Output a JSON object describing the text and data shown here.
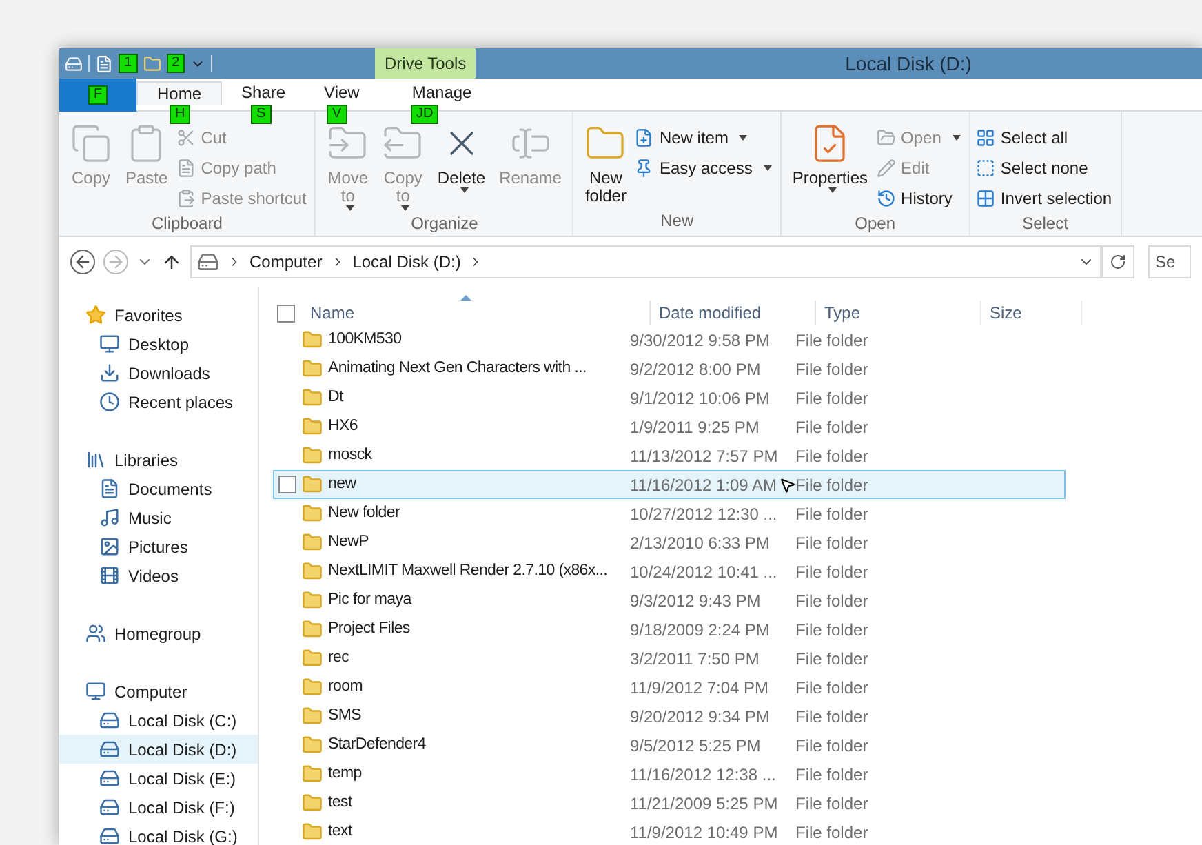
{
  "window": {
    "title": "Local Disk (D:)",
    "contextual_tab_group": "Drive Tools"
  },
  "keytips": {
    "file": "F",
    "quick_access": [
      "1",
      "2"
    ],
    "tabs": [
      "H",
      "S",
      "V",
      "JD"
    ]
  },
  "tabs": [
    {
      "label": "Home",
      "selected": true
    },
    {
      "label": "Share",
      "selected": false
    },
    {
      "label": "View",
      "selected": false
    },
    {
      "label": "Manage",
      "selected": false
    }
  ],
  "ribbon": [
    {
      "group": "Clipboard",
      "large": [
        {
          "label": "Copy",
          "disabled": true,
          "dropdown": false
        },
        {
          "label": "Paste",
          "disabled": true,
          "dropdown": false
        }
      ],
      "small": [
        {
          "label": "Cut",
          "disabled": true,
          "dropdown": false
        },
        {
          "label": "Copy path",
          "disabled": true,
          "dropdown": false
        },
        {
          "label": "Paste shortcut",
          "disabled": true,
          "dropdown": false
        }
      ]
    },
    {
      "group": "Organize",
      "large": [
        {
          "label": "Move to",
          "disabled": true,
          "dropdown": true
        },
        {
          "label": "Copy to",
          "disabled": true,
          "dropdown": true
        },
        {
          "label": "Delete",
          "disabled": false,
          "dropdown": true
        },
        {
          "label": "Rename",
          "disabled": true,
          "dropdown": false
        }
      ]
    },
    {
      "group": "New",
      "large": [
        {
          "label": "New folder",
          "disabled": false,
          "dropdown": false
        }
      ],
      "small": [
        {
          "label": "New item",
          "disabled": false,
          "dropdown": true
        },
        {
          "label": "Easy access",
          "disabled": false,
          "dropdown": true
        }
      ]
    },
    {
      "group": "Open",
      "large": [
        {
          "label": "Properties",
          "disabled": false,
          "dropdown": true
        }
      ],
      "small": [
        {
          "label": "Open",
          "disabled": true,
          "dropdown": true
        },
        {
          "label": "Edit",
          "disabled": true,
          "dropdown": false
        },
        {
          "label": "History",
          "disabled": false,
          "dropdown": false
        }
      ]
    },
    {
      "group": "Select",
      "small": [
        {
          "label": "Select all",
          "disabled": false,
          "dropdown": false
        },
        {
          "label": "Select none",
          "disabled": false,
          "dropdown": false
        },
        {
          "label": "Invert selection",
          "disabled": false,
          "dropdown": false
        }
      ]
    }
  ],
  "address_bar": {
    "path": [
      "Computer",
      "Local Disk (D:)"
    ],
    "search": "Se"
  },
  "sidebar": [
    {
      "label": "Favorites",
      "selected": false,
      "children": [
        {
          "label": "Desktop",
          "selected": false
        },
        {
          "label": "Downloads",
          "selected": false
        },
        {
          "label": "Recent places",
          "selected": false
        }
      ]
    },
    {
      "label": "Libraries",
      "selected": false,
      "children": [
        {
          "label": "Documents",
          "selected": false
        },
        {
          "label": "Music",
          "selected": false
        },
        {
          "label": "Pictures",
          "selected": false
        },
        {
          "label": "Videos",
          "selected": false
        }
      ]
    },
    {
      "label": "Homegroup",
      "selected": false
    },
    {
      "label": "Computer",
      "selected": false,
      "children": [
        {
          "label": "Local Disk (C:)",
          "selected": false
        },
        {
          "label": "Local Disk (D:)",
          "selected": true
        },
        {
          "label": "Local Disk (E:)",
          "selected": false
        },
        {
          "label": "Local Disk (F:)",
          "selected": false
        },
        {
          "label": "Local Disk (G:)",
          "selected": false
        }
      ]
    }
  ],
  "table": {
    "select_all_checked": false,
    "columns": [
      "Name",
      "Date modified",
      "Type",
      "Size"
    ],
    "rows": [
      {
        "name": "100KM530",
        "date": "9/30/2012 9:58 PM",
        "type": "File folder",
        "selected": false
      },
      {
        "name": "Animating Next Gen Characters with ...",
        "date": "9/2/2012 8:00 PM",
        "type": "File folder",
        "selected": false
      },
      {
        "name": "Dt",
        "date": "9/1/2012 10:06 PM",
        "type": "File folder",
        "selected": false
      },
      {
        "name": "HX6",
        "date": "1/9/2011 9:25 PM",
        "type": "File folder",
        "selected": false
      },
      {
        "name": "mosck",
        "date": "11/13/2012 7:57 PM",
        "type": "File folder",
        "selected": false
      },
      {
        "name": "new",
        "date": "11/16/2012 1:09 AM",
        "type": "File folder",
        "selected": true
      },
      {
        "name": "New folder",
        "date": "10/27/2012 12:30 ...",
        "type": "File folder",
        "selected": false
      },
      {
        "name": "NewP",
        "date": "2/13/2010 6:33 PM",
        "type": "File folder",
        "selected": false
      },
      {
        "name": "NextLIMIT Maxwell Render 2.7.10 (x86x...",
        "date": "10/24/2012 10:41 ...",
        "type": "File folder",
        "selected": false
      },
      {
        "name": "Pic for maya",
        "date": "9/3/2012 9:43 PM",
        "type": "File folder",
        "selected": false
      },
      {
        "name": "Project Files",
        "date": "9/18/2009 2:24 PM",
        "type": "File folder",
        "selected": false
      },
      {
        "name": "rec",
        "date": "3/2/2011 7:50 PM",
        "type": "File folder",
        "selected": false
      },
      {
        "name": "room",
        "date": "11/9/2012 7:04 PM",
        "type": "File folder",
        "selected": false
      },
      {
        "name": "SMS",
        "date": "9/20/2012 9:34 PM",
        "type": "File folder",
        "selected": false
      },
      {
        "name": "StarDefender4",
        "date": "9/5/2012 5:25 PM",
        "type": "File folder",
        "selected": false
      },
      {
        "name": "temp",
        "date": "11/16/2012 12:38 ...",
        "type": "File folder",
        "selected": false
      },
      {
        "name": "test",
        "date": "11/21/2009 5:25 PM",
        "type": "File folder",
        "selected": false
      },
      {
        "name": "text",
        "date": "11/9/2012 10:49 PM",
        "type": "File folder",
        "selected": false
      }
    ]
  }
}
